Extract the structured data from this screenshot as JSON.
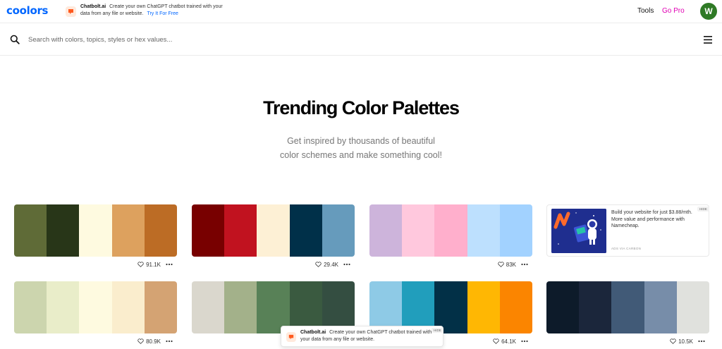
{
  "app": {
    "logo": "coolors"
  },
  "top_ad": {
    "brand": "Chatbolt.ai",
    "text": "Create your own ChatGPT chatbot trained with your data from any file or website.",
    "cta": "Try It For Free"
  },
  "nav": {
    "tools": "Tools",
    "go_pro": "Go Pro",
    "avatar_initial": "W"
  },
  "search": {
    "placeholder": "Search with colors, topics, styles or hex values..."
  },
  "hero": {
    "title": "Trending Color Palettes",
    "subtitle_line1": "Get inspired by thousands of beautiful",
    "subtitle_line2": "color schemes and make something cool!"
  },
  "palettes": [
    {
      "colors": [
        "#5f6b37",
        "#283618",
        "#fefae0",
        "#dda15e",
        "#bc6c25"
      ],
      "likes": "91.1K"
    },
    {
      "colors": [
        "#780000",
        "#c1121f",
        "#fdf0d5",
        "#003049",
        "#669bbc"
      ],
      "likes": "29.4K"
    },
    {
      "colors": [
        "#cdb4db",
        "#ffc8dd",
        "#ffafcc",
        "#bde0fe",
        "#a2d2ff"
      ],
      "likes": "83K"
    },
    {
      "colors": [
        "#ccd5ae",
        "#e9edc9",
        "#fefae0",
        "#faedcd",
        "#d4a373"
      ],
      "likes": "80.9K"
    },
    {
      "colors": [
        "#dad7cd",
        "#a3b18a",
        "#588157",
        "#3a5a40",
        "#344e41"
      ],
      "likes": ""
    },
    {
      "colors": [
        "#8ecae6",
        "#219ebc",
        "#023047",
        "#ffb703",
        "#fb8500"
      ],
      "likes": "64.1K"
    },
    {
      "colors": [
        "#0d1b2a",
        "#1b263b",
        "#415a77",
        "#778da9",
        "#e0e1dd"
      ],
      "likes": "10.5K"
    }
  ],
  "side_ad": {
    "text": "Build your website for just $3.88/mth. More value and performance with Namecheap.",
    "via": "ADS VIA CARBON",
    "hide": "HIDE"
  },
  "bottom_ad": {
    "brand": "Chatbolt.ai",
    "text": "Create your own ChatGPT chatbot trained with your data from any file or website.",
    "hide": "HIDE"
  },
  "colors": {
    "brand_blue": "#0066ff",
    "go_pro_magenta": "#e000b4",
    "avatar_green": "#2f7a26"
  }
}
